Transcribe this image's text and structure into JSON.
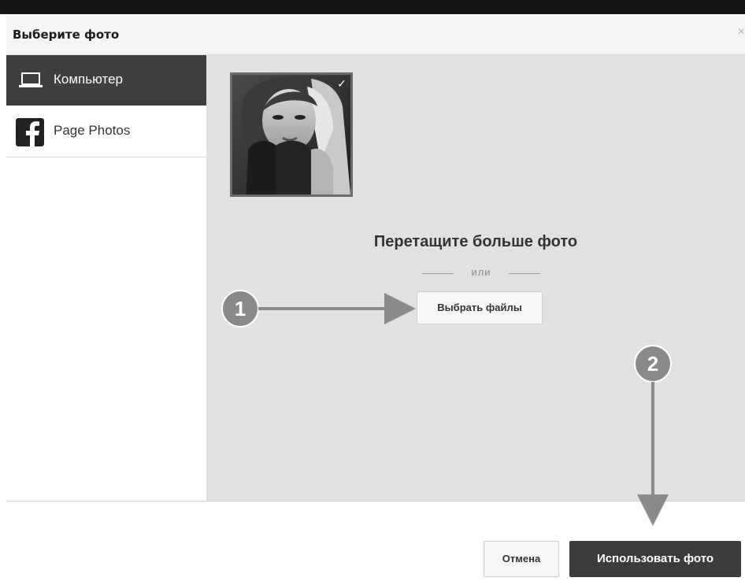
{
  "dialog": {
    "title": "Выберите фото",
    "close_label": "×"
  },
  "sidebar": {
    "items": [
      {
        "label": "Компьютер",
        "icon": "laptop-icon",
        "active": true
      },
      {
        "label": "Page Photos",
        "icon": "facebook-icon",
        "active": false
      }
    ]
  },
  "content": {
    "check_glyph": "✓",
    "drag_text": "Перетащите больше фото",
    "or_text": "или",
    "choose_files_label": "Выбрать файлы"
  },
  "footer": {
    "cancel_label": "Отмена",
    "use_photo_label": "Использовать фото"
  },
  "annotations": {
    "markers": [
      "1",
      "2"
    ]
  },
  "colors": {
    "active_sidebar": "#3f3f3f",
    "content_bg": "#e1e1e1",
    "primary_button": "#3c3c3c",
    "annotation": "#8a8a8a"
  }
}
